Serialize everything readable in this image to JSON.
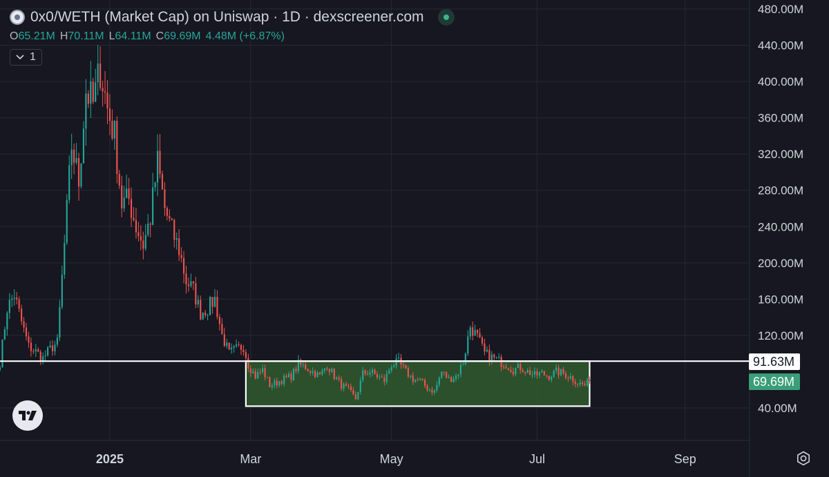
{
  "header": {
    "title": "0x0/WETH (Market Cap) on Uniswap · 1D · dexscreener.com",
    "ohlc": [
      {
        "k": "O",
        "v": "65.21M"
      },
      {
        "k": "H",
        "v": "70.11M"
      },
      {
        "k": "L",
        "v": "64.11M"
      },
      {
        "k": "C",
        "v": "69.69M"
      }
    ],
    "change": "4.48M (+6.87%)",
    "collapse_label": "1"
  },
  "price_tags": {
    "level": "91.63M",
    "last": "69.69M"
  },
  "colors": {
    "up": "#26a69a",
    "down": "#ef5350",
    "background": "#161720",
    "grid": "#262833",
    "range_fill": "#2f5a2e",
    "accent_green": "#3a9e78"
  },
  "icons": [
    "logo-icon",
    "status-dot-icon",
    "chevron-down-icon",
    "tradingview-logo-icon",
    "settings-icon"
  ],
  "chart_data": {
    "type": "candlestick",
    "ylim": [
      10,
      490
    ],
    "yticks": [
      "480.00M",
      "440.00M",
      "400.00M",
      "360.00M",
      "320.00M",
      "280.00M",
      "240.00M",
      "200.00M",
      "160.00M",
      "120.00M",
      "40.00M"
    ],
    "ytick_values": [
      480,
      440,
      400,
      360,
      320,
      280,
      240,
      200,
      160,
      120,
      40
    ],
    "xticks": [
      "2025",
      "Mar",
      "May",
      "Jul",
      "Sep"
    ],
    "xtick_days": [
      31,
      90,
      149,
      210,
      272
    ],
    "x_range_days": [
      -15,
      299
    ],
    "horizontal_level": 91.63,
    "range_box": {
      "start_day": 88,
      "end_day": 232,
      "top": 91.63,
      "bottom": 42
    },
    "last_close": 69.69,
    "anchors": [
      [
        -15,
        90
      ],
      [
        -12,
        150
      ],
      [
        -9,
        165
      ],
      [
        -6,
        135
      ],
      [
        -3,
        108
      ],
      [
        0,
        102
      ],
      [
        3,
        95
      ],
      [
        6,
        105
      ],
      [
        9,
        112
      ],
      [
        12,
        220
      ],
      [
        15,
        330
      ],
      [
        18,
        290
      ],
      [
        21,
        390
      ],
      [
        24,
        375
      ],
      [
        27,
        415
      ],
      [
        30,
        370
      ],
      [
        33,
        340
      ],
      [
        36,
        265
      ],
      [
        39,
        270
      ],
      [
        42,
        240
      ],
      [
        45,
        220
      ],
      [
        48,
        250
      ],
      [
        51,
        310
      ],
      [
        54,
        260
      ],
      [
        57,
        235
      ],
      [
        60,
        215
      ],
      [
        63,
        180
      ],
      [
        66,
        170
      ],
      [
        69,
        145
      ],
      [
        72,
        150
      ],
      [
        75,
        160
      ],
      [
        78,
        120
      ],
      [
        81,
        100
      ],
      [
        84,
        105
      ],
      [
        87,
        108
      ],
      [
        89,
        88
      ],
      [
        92,
        75
      ],
      [
        95,
        82
      ],
      [
        98,
        65
      ],
      [
        101,
        68
      ],
      [
        104,
        72
      ],
      [
        107,
        75
      ],
      [
        110,
        88
      ],
      [
        113,
        85
      ],
      [
        116,
        80
      ],
      [
        119,
        75
      ],
      [
        122,
        88
      ],
      [
        125,
        75
      ],
      [
        128,
        65
      ],
      [
        131,
        60
      ],
      [
        134,
        50
      ],
      [
        137,
        78
      ],
      [
        140,
        80
      ],
      [
        143,
        75
      ],
      [
        146,
        70
      ],
      [
        149,
        88
      ],
      [
        152,
        90
      ],
      [
        155,
        80
      ],
      [
        158,
        72
      ],
      [
        161,
        70
      ],
      [
        164,
        62
      ],
      [
        167,
        58
      ],
      [
        170,
        80
      ],
      [
        173,
        72
      ],
      [
        176,
        75
      ],
      [
        179,
        90
      ],
      [
        182,
        130
      ],
      [
        185,
        118
      ],
      [
        188,
        100
      ],
      [
        191,
        96
      ],
      [
        194,
        92
      ],
      [
        197,
        88
      ],
      [
        200,
        82
      ],
      [
        203,
        85
      ],
      [
        206,
        80
      ],
      [
        209,
        76
      ],
      [
        212,
        78
      ],
      [
        215,
        75
      ],
      [
        218,
        80
      ],
      [
        221,
        78
      ],
      [
        224,
        74
      ],
      [
        227,
        68
      ],
      [
        230,
        65
      ],
      [
        232,
        69.69
      ]
    ]
  }
}
